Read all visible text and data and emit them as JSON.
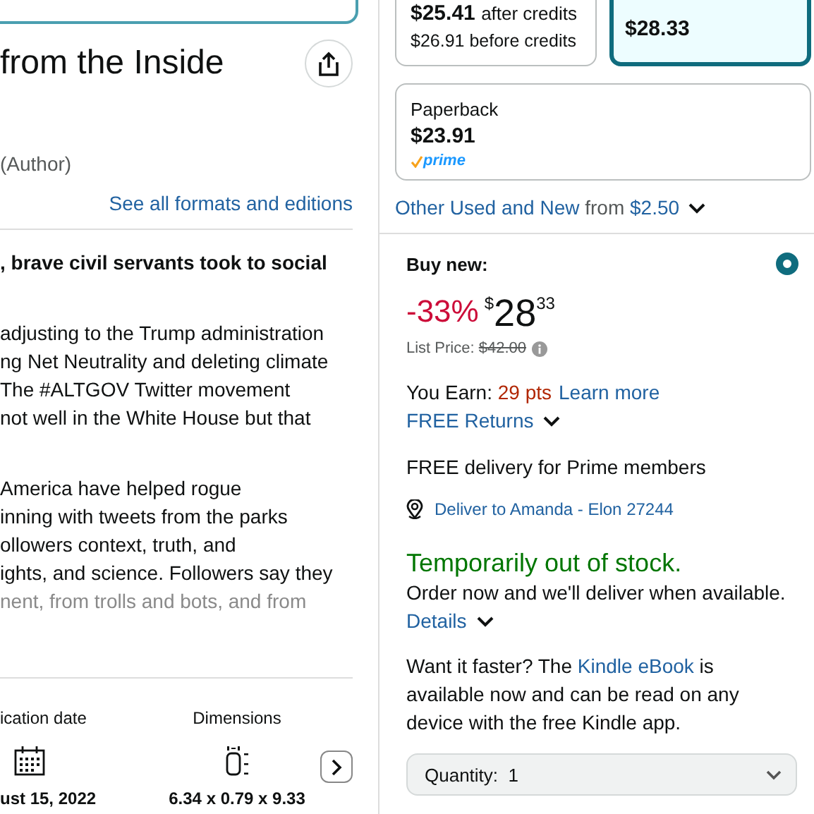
{
  "product": {
    "title": "from the Inside",
    "author_role": "(Author)",
    "formats_link": "See all formats and editions"
  },
  "description": {
    "headline": ", brave civil servants took to social",
    "paragraphs": [
      [
        "adjusting to the Trump administration",
        "ng Net Neutrality and deleting climate",
        "The #ALTGOV Twitter movement",
        "not well in the White House but that"
      ],
      [
        "America have helped rogue",
        "inning with tweets from the parks",
        "ollowers context, truth, and",
        "ights, and science. Followers say they",
        "nent, from trolls and bots, and from"
      ]
    ]
  },
  "details": {
    "columns": [
      {
        "kind": "date",
        "label": "ication date",
        "value": "ust 15, 2022"
      },
      {
        "kind": "size",
        "label": "Dimensions",
        "value": "6.34 x 0.79 x 9.33"
      }
    ]
  },
  "format_rows": [
    [
      {
        "kind": "ebook",
        "price": "$25.41",
        "price_note": "after credits",
        "secondary": "$26.91 before credits",
        "selected": false
      },
      {
        "kind": "hardcover",
        "price": "$28.33",
        "selected": true
      }
    ],
    [
      {
        "kind": "paperback",
        "name": "Paperback",
        "price": "$23.91",
        "badge": "prime",
        "selected": false
      }
    ]
  ],
  "other_offers": {
    "link": "Other Used and New",
    "text": "from",
    "price": "$2.50"
  },
  "buy_box": {
    "heading": "Buy new:",
    "selected": true,
    "discount": "-33%",
    "currency": "$",
    "price_whole": "28",
    "price_fraction": "33",
    "list_price_label": "List Price:",
    "list_price": "$42.00",
    "earn_label": "You Earn:",
    "earn_points": "29 pts",
    "learn_more": "Learn more",
    "returns": "FREE Returns",
    "delivery": "FREE delivery for Prime members",
    "deliver_to": "Deliver to Amanda - Elon 27244",
    "stock": "Temporarily out of stock.",
    "stock_note": "Order now and we'll deliver when available.",
    "details_link": "Details",
    "faster_before": "Want it faster? The",
    "faster_link": "Kindle eBook",
    "faster_after": "is available now and can be read on any device with the free Kindle app.",
    "quantity_label": "Quantity:",
    "quantity": "1"
  }
}
